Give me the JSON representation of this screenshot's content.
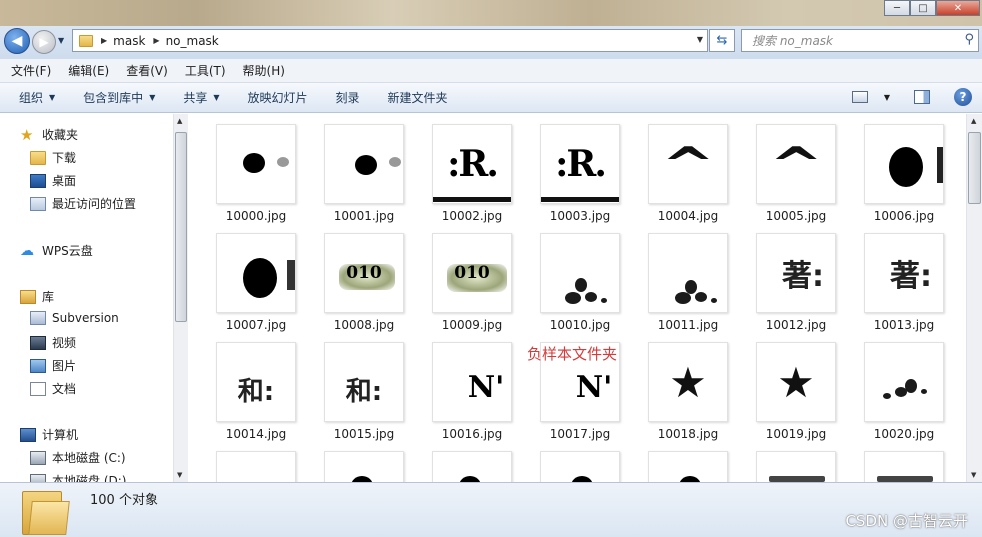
{
  "window": {
    "buttons": [
      "minimize",
      "maximize",
      "close"
    ]
  },
  "address_bar": {
    "crumbs": [
      "mask",
      "no_mask"
    ],
    "search_placeholder": "搜索 no_mask"
  },
  "menu": [
    "文件(F)",
    "编辑(E)",
    "查看(V)",
    "工具(T)",
    "帮助(H)"
  ],
  "toolbar": {
    "organize": "组织",
    "include_in_library": "包含到库中",
    "share": "共享",
    "slideshow": "放映幻灯片",
    "burn": "刻录",
    "new_folder": "新建文件夹"
  },
  "nav_pane": {
    "favorites": "收藏夹",
    "downloads": "下载",
    "desktop": "桌面",
    "recent": "最近访问的位置",
    "wps_cloud": "WPS云盘",
    "libraries": "库",
    "subversion": "Subversion",
    "videos": "视频",
    "pictures": "图片",
    "documents": "文档",
    "computer": "计算机",
    "drive_c": "本地磁盘 (C:)",
    "drive_d": "本地磁盘 (D:)"
  },
  "files": [
    "10000.jpg",
    "10001.jpg",
    "10002.jpg",
    "10003.jpg",
    "10004.jpg",
    "10005.jpg",
    "10006.jpg",
    "10007.jpg",
    "10008.jpg",
    "10009.jpg",
    "10010.jpg",
    "10011.jpg",
    "10012.jpg",
    "10013.jpg",
    "10014.jpg",
    "10015.jpg",
    "10016.jpg",
    "10017.jpg",
    "10018.jpg",
    "10019.jpg",
    "10020.jpg"
  ],
  "overlay_annotation": "负样本文件夹",
  "details": {
    "count": "100 个对象",
    "watermark": "CSDN @古智云开"
  },
  "colors": {
    "annotation_red": "#d43b3b",
    "toolbar_text": "#1e3958"
  }
}
